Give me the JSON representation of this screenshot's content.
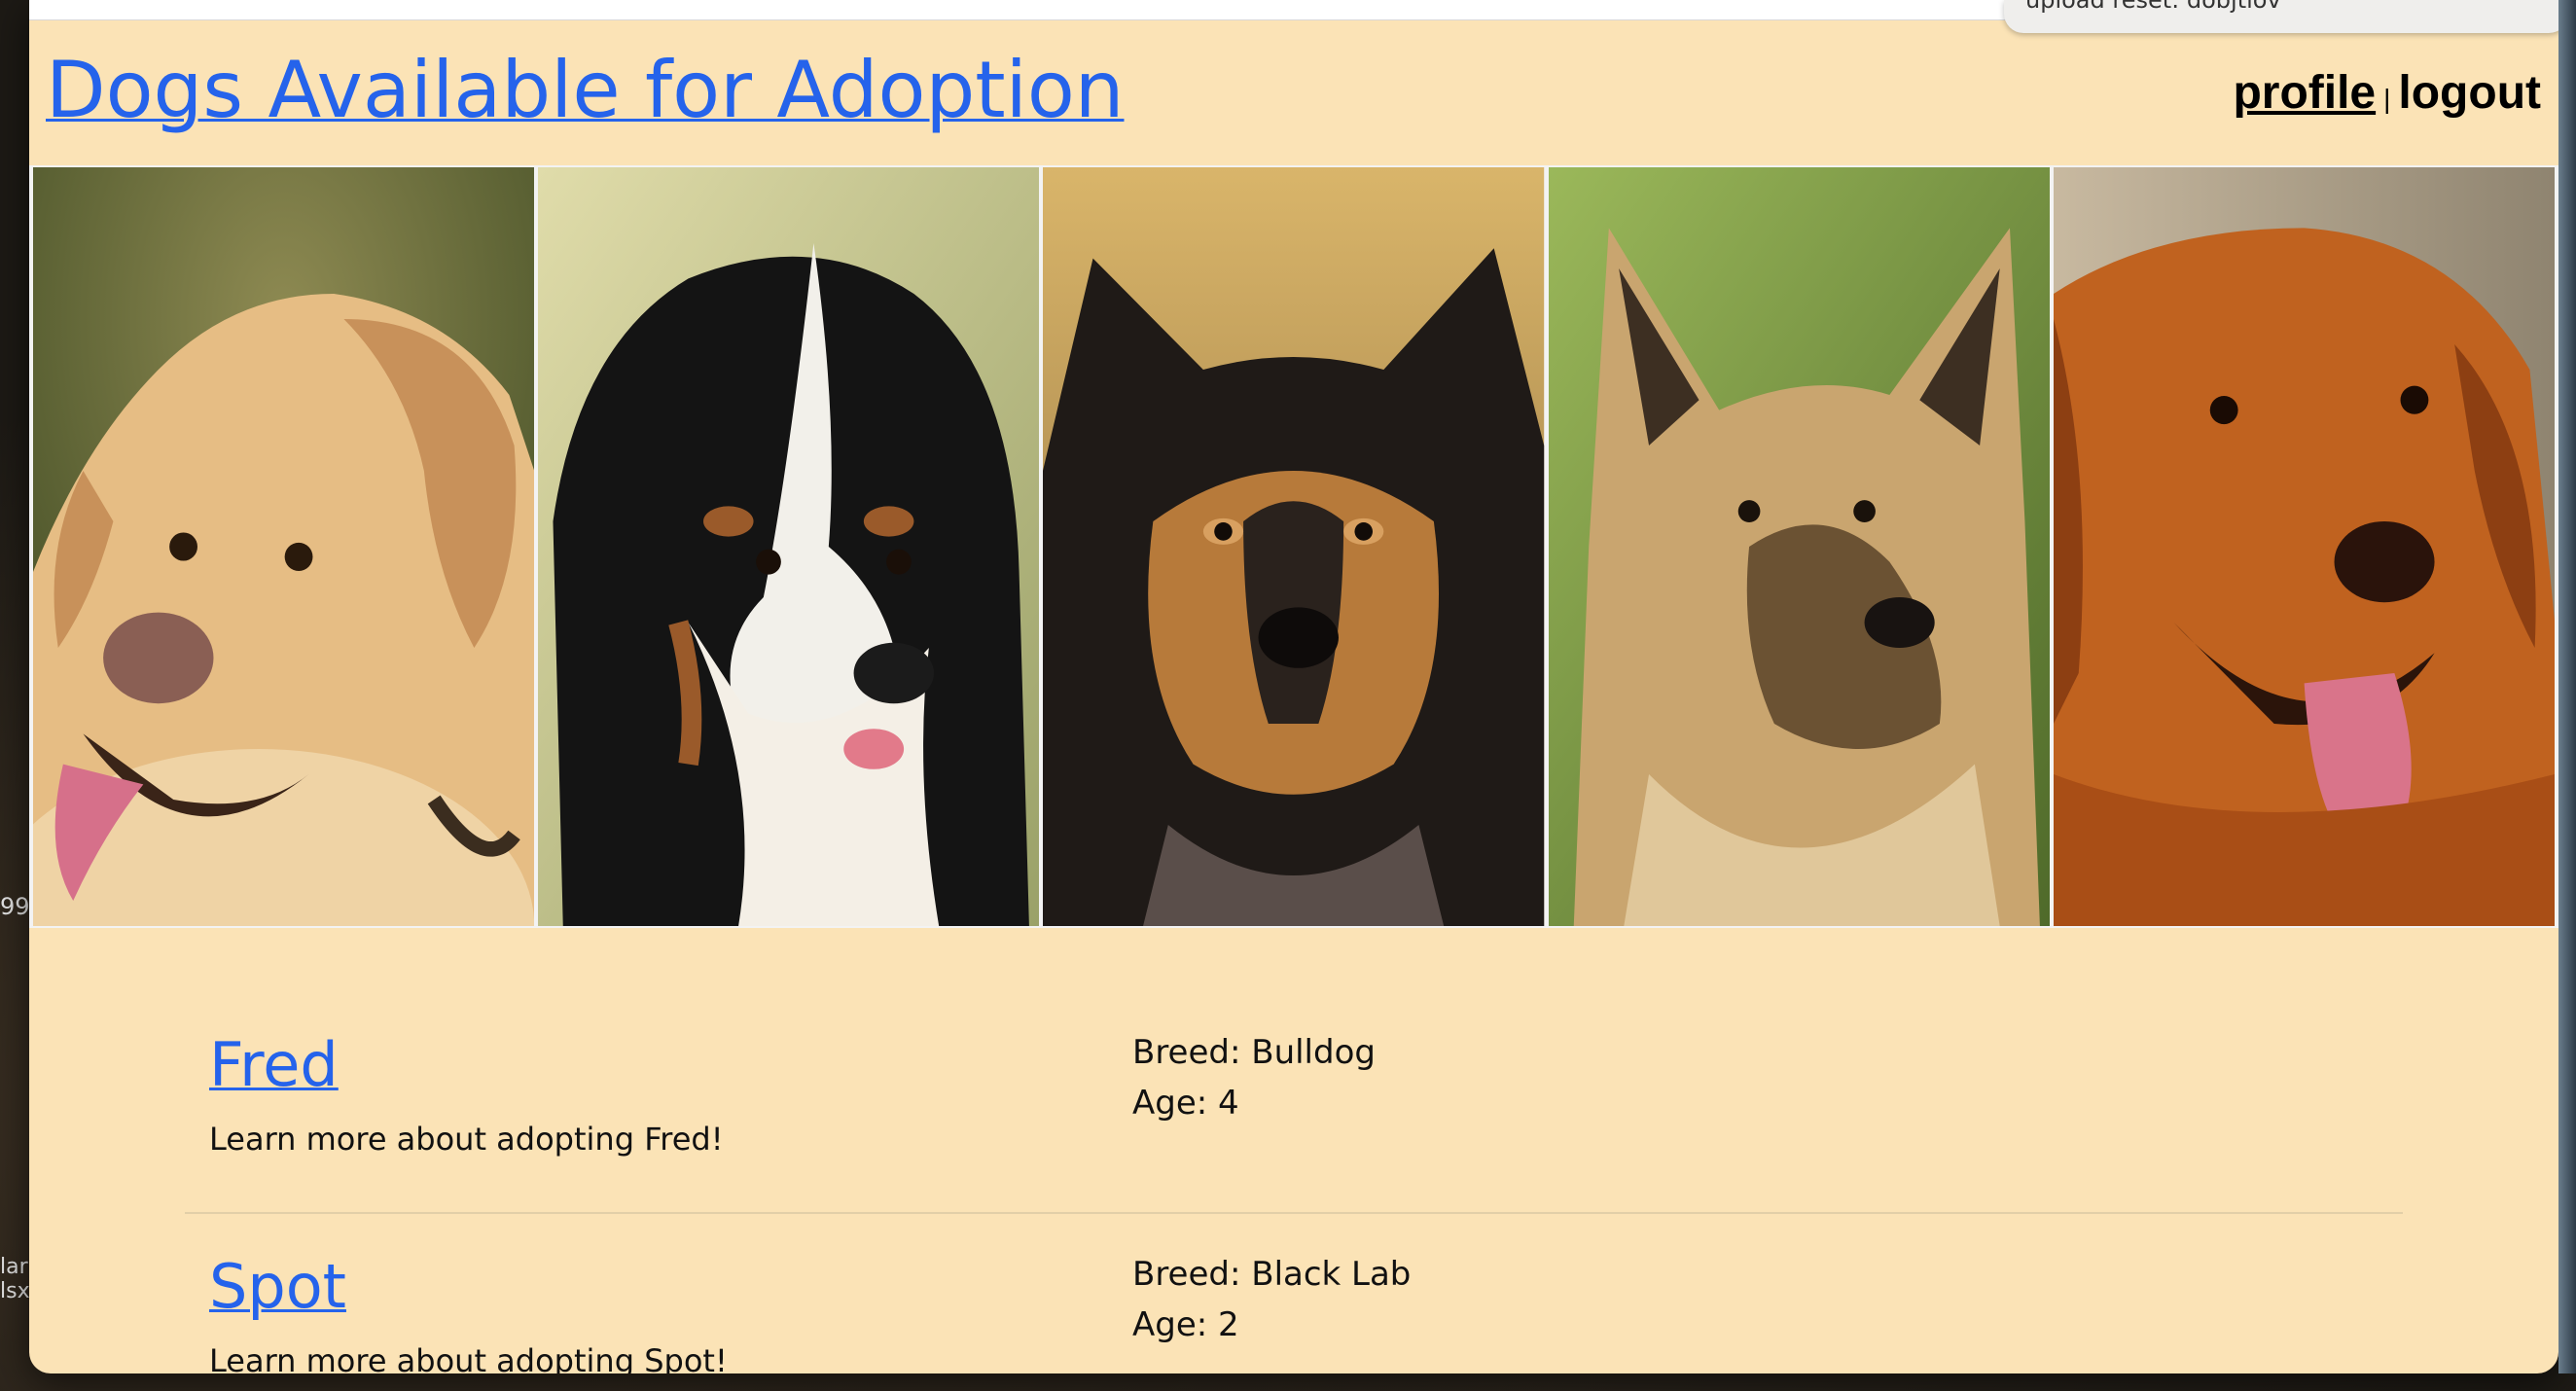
{
  "notification": {
    "text": "upload reset: dobjtlov"
  },
  "header": {
    "title": "Dogs Available for Adoption",
    "nav": {
      "profile": "profile",
      "separator": "|",
      "logout": "logout"
    }
  },
  "banner": {
    "photos": [
      {
        "name": "yellow-labrador",
        "colors": {
          "bg": "#5b6b33",
          "fur": "#e6bd84",
          "shade": "#c8915a"
        }
      },
      {
        "name": "bernese-mountain-dog",
        "colors": {
          "bg": "#c9c08a",
          "fur": "#141414",
          "shade": "#9a5a2a"
        }
      },
      {
        "name": "sheltie",
        "colors": {
          "bg": "#c8a45c",
          "fur": "#1f1a17",
          "shade": "#b77a3a"
        }
      },
      {
        "name": "shepherd",
        "colors": {
          "bg": "#6d8a3b",
          "fur": "#c9a56f",
          "shade": "#6b5233"
        }
      },
      {
        "name": "golden-retriever",
        "colors": {
          "bg": "#b7a488",
          "fur": "#c0621f",
          "shade": "#8d3f12"
        }
      }
    ]
  },
  "dogs": [
    {
      "name": "Fred",
      "blurb": "Learn more about adopting Fred!",
      "breed": "Breed: Bulldog",
      "age": "Age: 4"
    },
    {
      "name": "Spot",
      "blurb": "Learn more about adopting Spot!",
      "breed": "Breed: Black Lab",
      "age": "Age: 2"
    }
  ],
  "colors": {
    "page_bg": "#fbe3b6",
    "link": "#2563eb",
    "text": "#111111"
  }
}
